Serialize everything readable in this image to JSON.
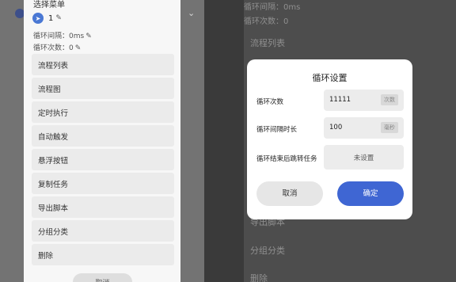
{
  "menu": {
    "title": "选择菜单",
    "task_id": "1",
    "loop_interval": "循环间隔：0ms",
    "loop_count": "循环次数：0",
    "items": [
      "流程列表",
      "流程图",
      "定时执行",
      "自动触发",
      "悬浮按钮",
      "复制任务",
      "导出脚本",
      "分组分类",
      "删除"
    ],
    "cancel_label": "取消"
  },
  "background": {
    "loop_interval": "循环间隔：0ms",
    "loop_count": "循环次数：0",
    "items": [
      "流程列表",
      "导出脚本",
      "分组分类",
      "删除"
    ]
  },
  "dialog": {
    "title": "循环设置",
    "count_label": "循环次数",
    "count_value": "11111",
    "count_unit": "次数",
    "interval_label": "循环间隔时长",
    "interval_value": "100",
    "interval_unit": "毫秒",
    "jump_label": "循环结束后跳转任务",
    "jump_value": "未设置",
    "cancel_label": "取消",
    "ok_label": "确定"
  },
  "colors": {
    "accent": "#3f66d3",
    "app_icon": "#4a78d4"
  }
}
